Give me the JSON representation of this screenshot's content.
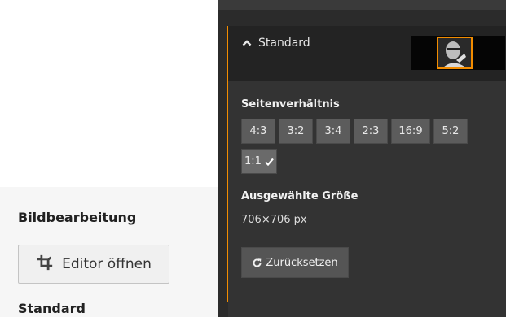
{
  "left": {
    "section_title": "Bildbearbeitung",
    "editor_button_label": "Editor öffnen",
    "bottom_label": "Standard"
  },
  "crop_panel": {
    "header_title": "Standard",
    "aspect_label": "Seitenverhältnis",
    "ratios": [
      {
        "label": "4:3",
        "selected": false
      },
      {
        "label": "3:2",
        "selected": false
      },
      {
        "label": "3:4",
        "selected": false
      },
      {
        "label": "2:3",
        "selected": false
      },
      {
        "label": "16:9",
        "selected": false
      },
      {
        "label": "5:2",
        "selected": false
      },
      {
        "label": "1:1",
        "selected": true
      }
    ],
    "size_label": "Ausgewählte Größe",
    "size_value": "706×706 px",
    "reset_label": "Zurücksetzen"
  },
  "colors": {
    "accent": "#f28c00",
    "panel_bg": "#2b2b2b",
    "button_bg": "#5c5c5c"
  },
  "icons": {
    "editor": "crop-icon",
    "header_toggle": "chevron-up-icon",
    "selected_mark": "check-icon",
    "reset": "refresh-icon"
  }
}
